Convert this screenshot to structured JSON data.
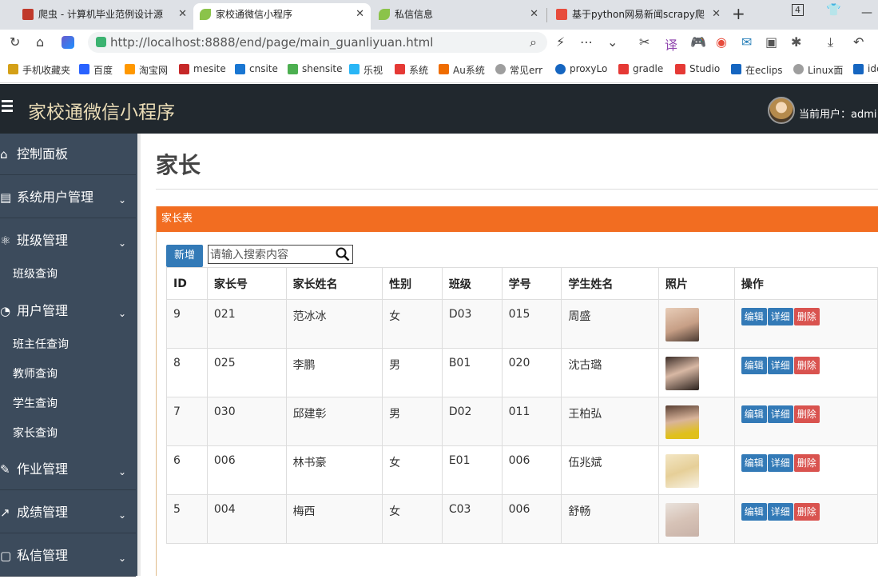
{
  "browser": {
    "tabs": [
      {
        "title": "爬虫 - 计算机毕业范例设计源",
        "color": "#c0392b"
      },
      {
        "title": "家校通微信小程序",
        "color": "#8bc34a"
      },
      {
        "title": "私信信息",
        "color": "#8bc34a"
      },
      {
        "title": "基于python网易新闻scrapy爬",
        "color": "#e74c3c"
      }
    ],
    "url": "http://localhost:8888/end/page/main_guanliyuan.html",
    "bookmarks": [
      "手机收藏夹",
      "百度",
      "淘宝网",
      "mesite",
      "cnsite",
      "shensite",
      "乐视",
      "系统",
      "Au系统",
      "常见err",
      "proxyLo",
      "gradle",
      "Studio",
      "在eclips",
      "Linux面",
      "ide"
    ],
    "tab_count": "4"
  },
  "header": {
    "app_title": "家校通微信小程序",
    "current_user": "当前用户：admi"
  },
  "sidebar": {
    "items": [
      {
        "label": "控制面板",
        "icon": "home-icon"
      },
      {
        "label": "系统用户管理",
        "icon": "list-icon"
      },
      {
        "label": "班级管理",
        "icon": "atom-icon"
      },
      {
        "label": "班级查询"
      },
      {
        "label": "用户管理",
        "icon": "pie-icon"
      },
      {
        "label": "班主任查询"
      },
      {
        "label": "教师查询"
      },
      {
        "label": "学生查询"
      },
      {
        "label": "家长查询"
      },
      {
        "label": "作业管理",
        "icon": "edit-icon"
      },
      {
        "label": "成绩管理",
        "icon": "share-icon"
      },
      {
        "label": "私信管理",
        "icon": "doc-icon"
      }
    ]
  },
  "main": {
    "page_title": "家长",
    "panel_title": "家长表",
    "add_label": "新增",
    "search_placeholder": "请输入搜索内容",
    "columns": [
      "ID",
      "家长号",
      "家长姓名",
      "性别",
      "班级",
      "学号",
      "学生姓名",
      "照片",
      "操作"
    ],
    "rows": [
      {
        "id": "9",
        "parent_no": "021",
        "parent_name": "范冰冰",
        "gender": "女",
        "class": "D03",
        "student_no": "015",
        "student_name": "周盛"
      },
      {
        "id": "8",
        "parent_no": "025",
        "parent_name": "李鹏",
        "gender": "男",
        "class": "B01",
        "student_no": "020",
        "student_name": "沈古璐"
      },
      {
        "id": "7",
        "parent_no": "030",
        "parent_name": "邱建彰",
        "gender": "男",
        "class": "D02",
        "student_no": "011",
        "student_name": "王柏弘"
      },
      {
        "id": "6",
        "parent_no": "006",
        "parent_name": "林书豪",
        "gender": "女",
        "class": "E01",
        "student_no": "006",
        "student_name": "伍兆斌"
      },
      {
        "id": "5",
        "parent_no": "004",
        "parent_name": "梅西",
        "gender": "女",
        "class": "C03",
        "student_no": "006",
        "student_name": "舒畅"
      }
    ],
    "ops": {
      "edit": "编辑",
      "detail": "详细",
      "delete": "删除"
    }
  }
}
